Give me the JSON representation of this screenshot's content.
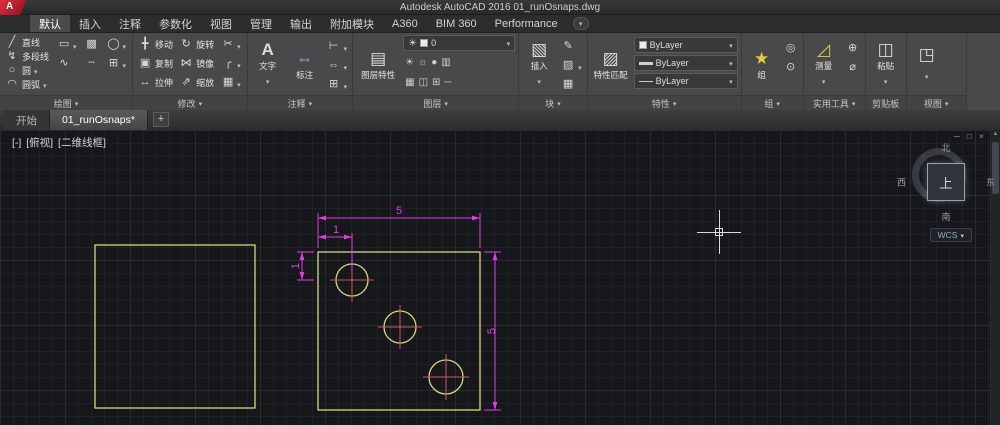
{
  "titlebar": {
    "title": "Autodesk AutoCAD 2016   01_runOsnaps.dwg"
  },
  "ribbon_tabs": [
    "默认",
    "插入",
    "注释",
    "参数化",
    "视图",
    "管理",
    "输出",
    "附加模块",
    "A360",
    "BIM 360",
    "Performance"
  ],
  "panels": {
    "draw": {
      "label": "绘图",
      "tools": [
        "直线",
        "多段线",
        "圆",
        "圆弧"
      ]
    },
    "modify": {
      "label": "修改",
      "tools": [
        "移动",
        "旋转",
        "复制",
        "镜像",
        "拉伸",
        "缩放"
      ]
    },
    "annotate": {
      "label": "注释",
      "tools": [
        "文字",
        "标注"
      ]
    },
    "layers": {
      "label": "图层",
      "properties_tool": "图层特性",
      "current_layer": "0"
    },
    "block": {
      "label": "块",
      "insert_tool": "插入"
    },
    "properties": {
      "label": "特性",
      "match_tool": "特性匹配",
      "color_value": "ByLayer",
      "lineweight_value": "ByLayer",
      "linetype_value": "ByLayer"
    },
    "groups": {
      "label": "组",
      "group_tool": "组"
    },
    "utilities": {
      "label": "实用工具",
      "measure_tool": "测量"
    },
    "clipboard": {
      "label": "剪贴板",
      "paste_tool": "粘贴"
    },
    "view": {
      "label": "视图"
    }
  },
  "file_tabs": {
    "start": "开始",
    "drawing": "01_runOsnaps*",
    "new_button": "+"
  },
  "canvas": {
    "viewport_controls": [
      "[-]",
      "[俯视]",
      "[二维线框]"
    ],
    "viewcube": {
      "north": "北",
      "south": "南",
      "east": "东",
      "west": "西",
      "top": "上"
    },
    "wcs_label": "WCS",
    "dimensions": {
      "plate_width": "5",
      "hole_offset_x": "1",
      "hole_offset_y": "1",
      "plate_height": "5"
    }
  },
  "icons": {
    "line": "╱",
    "polyline": "↯",
    "circle": "○",
    "arc": "◠",
    "rectangle": "▭",
    "hatch": "▩",
    "ellipse": "◯",
    "spline": "∿",
    "table": "⊞",
    "construction": "┄",
    "move": "╋",
    "rotate": "↻",
    "trim": "✂",
    "copy": "▣",
    "mirror": "⋈",
    "fillet": "╭",
    "stretch": "↔",
    "scale": "⇗",
    "array": "▦",
    "text": "A",
    "dimension": "⇔",
    "leader": "⊢",
    "layer_properties": "▤",
    "bulb": "☀",
    "insert": "▧",
    "match_properties": "▨",
    "group": "★",
    "measure": "◿",
    "paste": "◫",
    "base": "◳",
    "minimize": "─",
    "restore": "□",
    "close": "×",
    "caret": "▾",
    "layer_extra": [
      "☀",
      "☼",
      "●",
      "▥",
      "▦",
      "◫",
      "⊞",
      "─"
    ],
    "block_extra": [
      "✎",
      "▨",
      "▦"
    ],
    "group_extra": [
      "◎",
      "⊙"
    ],
    "utility_extra": [
      "⊕",
      "⌀"
    ],
    "annotate_extra": [
      "⊢",
      "⇔",
      "⊞"
    ]
  },
  "colors": {
    "geometry_yellow": "#d6d687",
    "dimension_magenta": "#e23de2",
    "center_mark_red": "#d85555",
    "logo_red": "#c01b2d",
    "bulb_yellow": "#e8c93e"
  }
}
